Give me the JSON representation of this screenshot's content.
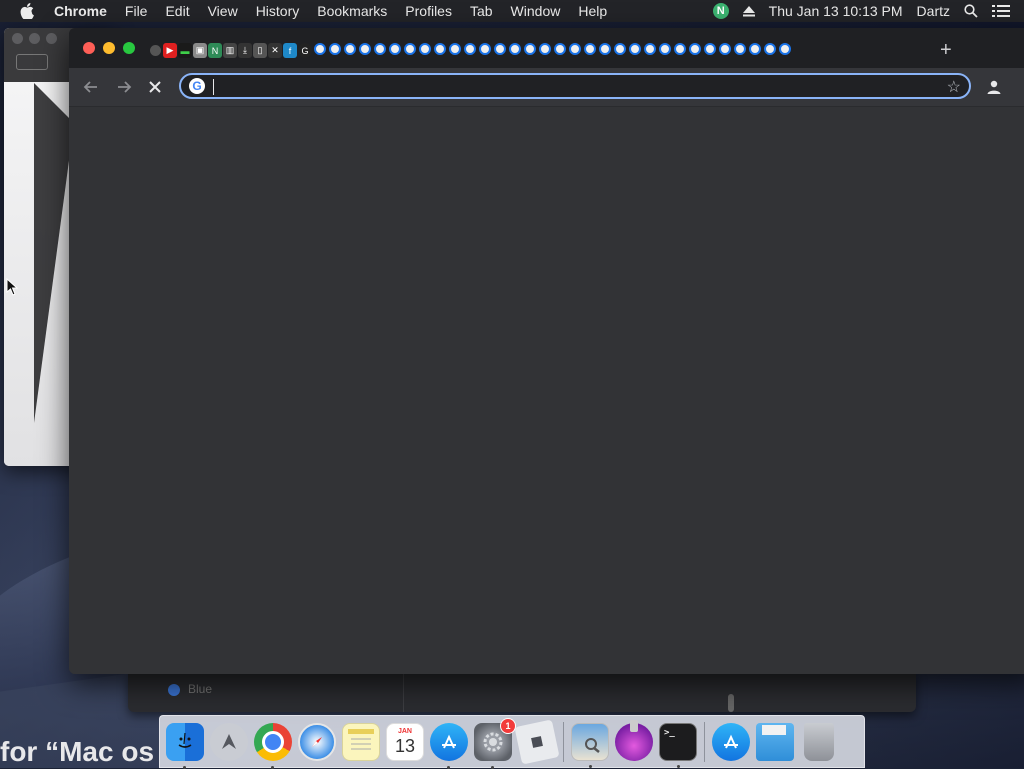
{
  "menubar": {
    "app_name": "Chrome",
    "items": [
      "File",
      "Edit",
      "View",
      "History",
      "Bookmarks",
      "Profiles",
      "Tab",
      "Window",
      "Help"
    ],
    "status_n": "N",
    "clock": "Thu Jan 13  10:13 PM",
    "user": "Dartz"
  },
  "chrome": {
    "tab_count_shown": 50,
    "new_tab_label": "+",
    "omnibox": {
      "value": "",
      "placeholder": ""
    },
    "colors": {
      "focus_ring": "#8ab4f8",
      "frame": "#1f2023",
      "toolbar": "#35363a",
      "content": "#323336"
    }
  },
  "background": {
    "list_label": "Blue",
    "bottom_text": "for “Mac os"
  },
  "dock": {
    "apps": [
      {
        "name": "finder-icon",
        "running": true
      },
      {
        "name": "launchpad-icon",
        "running": false
      },
      {
        "name": "chrome-icon",
        "running": true
      },
      {
        "name": "safari-icon",
        "running": false
      },
      {
        "name": "notes-icon",
        "running": false
      },
      {
        "name": "calendar-icon",
        "running": false,
        "month": "JAN",
        "day": "13"
      },
      {
        "name": "app-store-icon",
        "running": true
      },
      {
        "name": "system-preferences-icon",
        "running": true,
        "badge": "1"
      },
      {
        "name": "roblox-icon",
        "running": false
      },
      {
        "name": "preview-icon",
        "running": true
      },
      {
        "name": "potion-app-icon",
        "running": false
      },
      {
        "name": "terminal-icon",
        "running": true
      }
    ],
    "docked": [
      {
        "name": "app-store-folder-icon"
      },
      {
        "name": "documents-folder-icon"
      },
      {
        "name": "trash-icon"
      }
    ]
  }
}
